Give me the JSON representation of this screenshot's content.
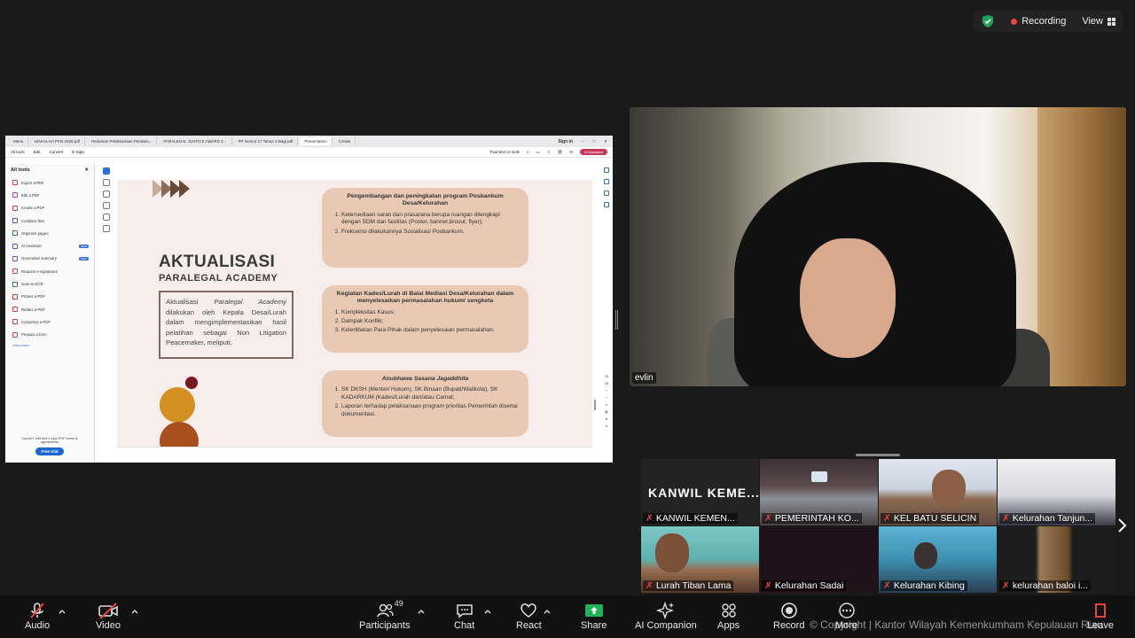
{
  "topbar": {
    "recording": "Recording",
    "view": "View"
  },
  "browser": {
    "tabs": [
      "Menu",
      "MAKALAH PKN 2025.pdf",
      "Pedoman Pelaksanaan Pendam...",
      "PARALEGAL JUSTICE AWARD 2...",
      "PP Nomor 17 Tahun 2 Bagi.pdf",
      "Presentation"
    ],
    "new_tab": "Create",
    "sign_in": "Sign in",
    "menu": [
      "All tools",
      "Edit",
      "Convert",
      "E-Sign"
    ],
    "find": "Find text or tools",
    "ai_assistant": "AI Assistant"
  },
  "tools_panel": {
    "title": "All tools",
    "items": [
      {
        "label": "Export a PDF",
        "color": "#d8413a"
      },
      {
        "label": "Edit a PDF",
        "color": "#c43b8a"
      },
      {
        "label": "Create a PDF",
        "color": "#d8413a"
      },
      {
        "label": "Combine files",
        "color": "#7a4bc9"
      },
      {
        "label": "Organize pages",
        "color": "#2f8a3c"
      },
      {
        "label": "AI Assistant",
        "color": "#7a4bc9",
        "badge": "NEW"
      },
      {
        "label": "Generative summary",
        "color": "#7a4bc9",
        "badge": "NEW"
      },
      {
        "label": "Request e-signatures",
        "color": "#c43b8a"
      },
      {
        "label": "Scan & OCR",
        "color": "#2f8a3c"
      },
      {
        "label": "Protect a PDF",
        "color": "#d8413a"
      },
      {
        "label": "Redact a PDF",
        "color": "#d8413a"
      },
      {
        "label": "Compress a PDF",
        "color": "#d8413a"
      },
      {
        "label": "Prepare a form",
        "color": "#c43b8a"
      }
    ],
    "view_more": "View more",
    "promo": "Convert, edit and e-sign PDF forms & agreements",
    "free_trial": "Free trial"
  },
  "page_numbers": [
    "29",
    "28"
  ],
  "slide": {
    "title": "AKTUALISASI",
    "subtitle": "PARALEGAL ACADEMY",
    "box_before": "Aktualisasi ",
    "box_italic": "Paralegal Academy",
    "box_after": " dilakukan oleh Kepala Desa/Lurah dalam mengimplementasikan hasil pelatihan sebagai Non Litigation Peacemaker, meliputi:",
    "cards": [
      {
        "title": "Pengembangan dan peningkatan program Posbankum Desa/Kelurahan",
        "items": [
          "Ketersediaan saran dan prasarana berupa ruangan dilengkapi dengan SDM dan fasilitas (Poster, banner,brosur, flyer);",
          "Frekuensi dilakukannya Sosialisasi Posbankum."
        ]
      },
      {
        "title": "Kegiatan Kades/Lurah di Balai Mediasi Desa/Kelurahan dalam menyelesaikan permasalahan hukum/ sengketa",
        "items": [
          "Kompleksitas Kasus;",
          "Dampak Konflik;",
          "Keterlibatan Para Pihak dalam penyelesaian permasalahan."
        ]
      },
      {
        "title": "Anubhawa Sasana Jagaddhita",
        "items": [
          "SK DKSH (Menteri Hukum), SK Binaan (Bupati/Walikota), SK KADARKUM (Kades/Lurah dan/atau Camat;",
          "Laporan terhadap pelaksanaan program prioritas Pemerintah disertai dokumentasi."
        ]
      }
    ]
  },
  "main_video": {
    "name": "evlin"
  },
  "gallery": [
    {
      "name": "KANWIL KEMEN...",
      "big": "KANWIL KEME..."
    },
    {
      "name": "PEMERINTAH KO..."
    },
    {
      "name": "KEL BATU SELICIN"
    },
    {
      "name": "Kelurahan Tanjun..."
    },
    {
      "name": "Lurah Tiban Lama"
    },
    {
      "name": "Kelurahan Sadai"
    },
    {
      "name": "Kelurahan Kibing"
    },
    {
      "name": "kelurahan baloi i..."
    }
  ],
  "controls": {
    "audio": "Audio",
    "video": "Video",
    "participants": "Participants",
    "participants_count": "49",
    "chat": "Chat",
    "react": "React",
    "share": "Share",
    "ai_companion": "AI Companion",
    "apps": "Apps",
    "record": "Record",
    "more": "More",
    "leave": "Leave"
  },
  "copyright": "© Copyright | Kantor Wilayah Kemenkumham Kepulauan Riau",
  "colors": {
    "share_green": "#1fb25a",
    "record_red": "#e8453c",
    "accent_blue": "#2d6fd6"
  }
}
